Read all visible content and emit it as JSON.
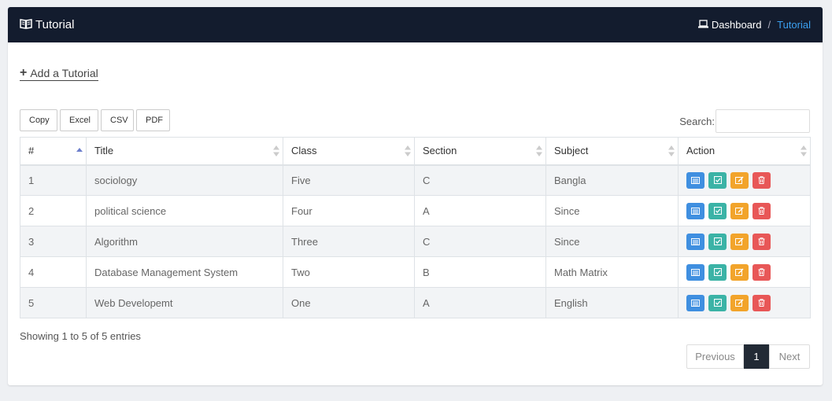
{
  "header": {
    "title": "Tutorial",
    "title_icon": "book-open-icon",
    "breadcrumb": {
      "dashboard_label": "Dashboard",
      "dashboard_icon": "laptop-icon",
      "separator": "/",
      "current": "Tutorial"
    }
  },
  "add_link": {
    "label": "Add a Tutorial",
    "icon": "plus-icon"
  },
  "export_buttons": [
    "Copy",
    "Excel",
    "CSV",
    "PDF"
  ],
  "search": {
    "label": "Search:",
    "value": ""
  },
  "table": {
    "columns": [
      "#",
      "Title",
      "Class",
      "Section",
      "Subject",
      "Action"
    ],
    "sorted_column": "#",
    "sort_direction": "asc",
    "rows": [
      {
        "num": "1",
        "title": "sociology",
        "class": "Five",
        "section": "C",
        "subject": "Bangla"
      },
      {
        "num": "2",
        "title": "political science",
        "class": "Four",
        "section": "A",
        "subject": "Since"
      },
      {
        "num": "3",
        "title": "Algorithm",
        "class": "Three",
        "section": "C",
        "subject": "Since"
      },
      {
        "num": "4",
        "title": "Database Management System",
        "class": "Two",
        "section": "B",
        "subject": "Math Matrix"
      },
      {
        "num": "5",
        "title": "Web Developemt",
        "class": "One",
        "section": "A",
        "subject": "English"
      }
    ],
    "action_icons": [
      "list-icon",
      "check-square-icon",
      "edit-icon",
      "trash-icon"
    ]
  },
  "info": "Showing 1 to 5 of 5 entries",
  "pagination": {
    "previous": "Previous",
    "current": "1",
    "next": "Next"
  },
  "colors": {
    "header_bg": "#131c2e",
    "breadcrumb_active": "#3ba0f0",
    "action_view": "#3f8fe0",
    "action_check": "#3bb3a6",
    "action_edit": "#f2a42b",
    "action_delete": "#e85757",
    "page_active": "#222a35"
  }
}
